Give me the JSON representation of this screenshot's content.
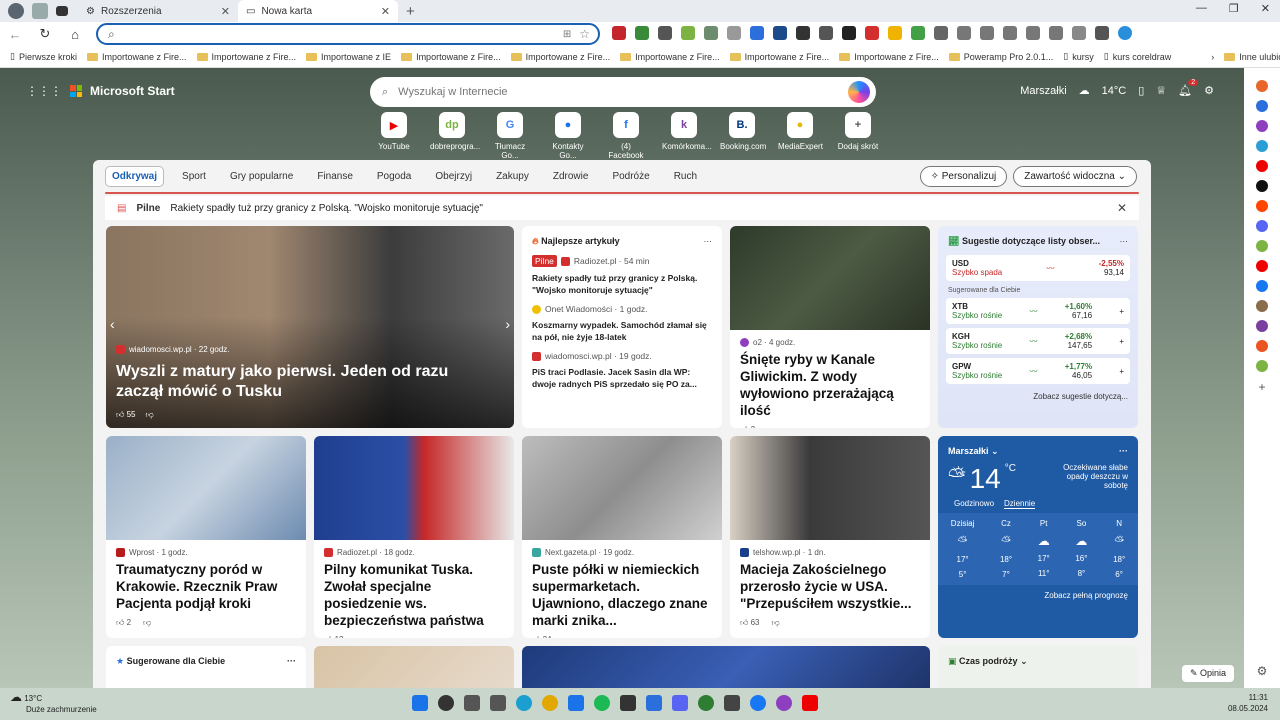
{
  "tabs": [
    {
      "label": "Rozszerzenia"
    },
    {
      "label": "Nowa karta"
    }
  ],
  "address": {
    "placeholder": ""
  },
  "bookmarks": [
    "Pierwsze kroki",
    "Importowane z Fire...",
    "Importowane z Fire...",
    "Importowane z IE",
    "Importowane z Fire...",
    "Importowane z Fire...",
    "Importowane z Fire...",
    "Importowane z Fire...",
    "Importowane z Fire...",
    "Poweramp Pro 2.0.1...",
    "kursy",
    "kurs coreldraw",
    "Inne ulubione"
  ],
  "header": {
    "brand": "Microsoft Start",
    "search_placeholder": "Wyszukaj w Internecie",
    "location": "Marszałki",
    "temp": "14°C",
    "notif_count": "2"
  },
  "quick_links": [
    "YouTube",
    "dobreprogra...",
    "Tłumacz Go...",
    "Kontakty Go...",
    "(4) Facebook",
    "Komórkoma...",
    "Booking.com",
    "MediaExpert",
    "Dodaj skrót"
  ],
  "categories": [
    "Odkrywaj",
    "Sport",
    "Gry popularne",
    "Finanse",
    "Pogoda",
    "Obejrzyj",
    "Zakupy",
    "Zdrowie",
    "Podróże",
    "Ruch"
  ],
  "personalize": "Personalizuj",
  "visible_content": "Zawartość widoczna",
  "breaking": {
    "label": "Pilne",
    "text": "Rakiety spadły tuż przy granicy z Polską. \"Wojsko monitoruje sytuację\""
  },
  "hero": {
    "source": "wiadomosci.wp.pl · 22 godz.",
    "title": "Wyszli z matury jako pierwsi. Jeden od razu zaczął mówić o Tusku",
    "likes": "55"
  },
  "top": {
    "header": "Najlepsze artykuły",
    "items": [
      {
        "badge": "Pilne",
        "source": "Radiozet.pl · 54 min",
        "title": "Rakiety spadły tuż przy granicy z Polską. \"Wojsko monitoruje sytuację\""
      },
      {
        "source": "Onet Wiadomości · 1 godz.",
        "title": "Koszmarny wypadek. Samochód złamał się na pół, nie żyje 18-latek"
      },
      {
        "source": "wiadomosci.wp.pl · 19 godz.",
        "title": "PiS traci Podlasie. Jacek Sasin dla WP: dwoje radnych PiS sprzedało się PO za..."
      }
    ]
  },
  "fish": {
    "source": "o2 · 4 godz.",
    "title": "Śnięte ryby w Kanale Gliwickim. Z wody wyłowiono przerażającą ilość",
    "likes": "2"
  },
  "stocks": {
    "header": "Sugestie dotyczące listy obser...",
    "usd": {
      "name": "USD",
      "sub": "Szybko spada",
      "chg": "-2,55%",
      "val": "93,14"
    },
    "sub_header": "Sugerowane dla Ciebie",
    "items": [
      {
        "name": "XTB",
        "sub": "Szybko rośnie",
        "chg": "+1,60%",
        "val": "67,16"
      },
      {
        "name": "KGH",
        "sub": "Szybko rośnie",
        "chg": "+2,68%",
        "val": "147,65"
      },
      {
        "name": "GPW",
        "sub": "Szybko rośnie",
        "chg": "+1,77%",
        "val": "46,05"
      }
    ],
    "more": "Zobacz sugestie dotyczą..."
  },
  "cards": [
    {
      "source": "Wprost · 1 godz.",
      "title": "Traumatyczny poród w Krakowie. Rzecznik Praw Pacjenta podjął kroki",
      "likes": "2"
    },
    {
      "source": "Radiozet.pl · 18 godz.",
      "title": "Pilny komunikat Tuska. Zwołał specjalne posiedzenie ws. bezpieczeństwa państwa",
      "likes": "12"
    },
    {
      "source": "Next.gazeta.pl · 19 godz.",
      "title": "Puste półki w niemieckich supermarketach. Ujawniono, dlaczego znane marki znika...",
      "likes": "24"
    },
    {
      "source": "telshow.wp.pl · 1 dn.",
      "title": "Macieja Zakościelnego przerosło życie w USA. \"Przepuściłem wszystkie...",
      "likes": "63"
    }
  ],
  "weather": {
    "city": "Marszałki",
    "temp": "14",
    "unit": "°C",
    "desc": "Oczekiwane słabe opady deszczu w sobotę",
    "tab1": "Godzinowo",
    "tab2": "Dziennie",
    "days": [
      {
        "d": "Dzisiaj",
        "hi": "17°",
        "lo": "5°"
      },
      {
        "d": "Cz",
        "hi": "18°",
        "lo": "7°"
      },
      {
        "d": "Pt",
        "hi": "17°",
        "lo": "11°"
      },
      {
        "d": "So",
        "hi": "16°",
        "lo": "8°"
      },
      {
        "d": "N",
        "hi": "18°",
        "lo": "6°"
      }
    ],
    "more": "Zobacz pełną prognozę"
  },
  "bottom": {
    "suggested": "Sugerowane dla Ciebie",
    "travel": "Czas podróży"
  },
  "opinion": "Opinia",
  "taskbar": {
    "temp": "13°C",
    "weather": "Duże zachmurzenie",
    "time": "11:31",
    "date": "08.05.2024"
  }
}
